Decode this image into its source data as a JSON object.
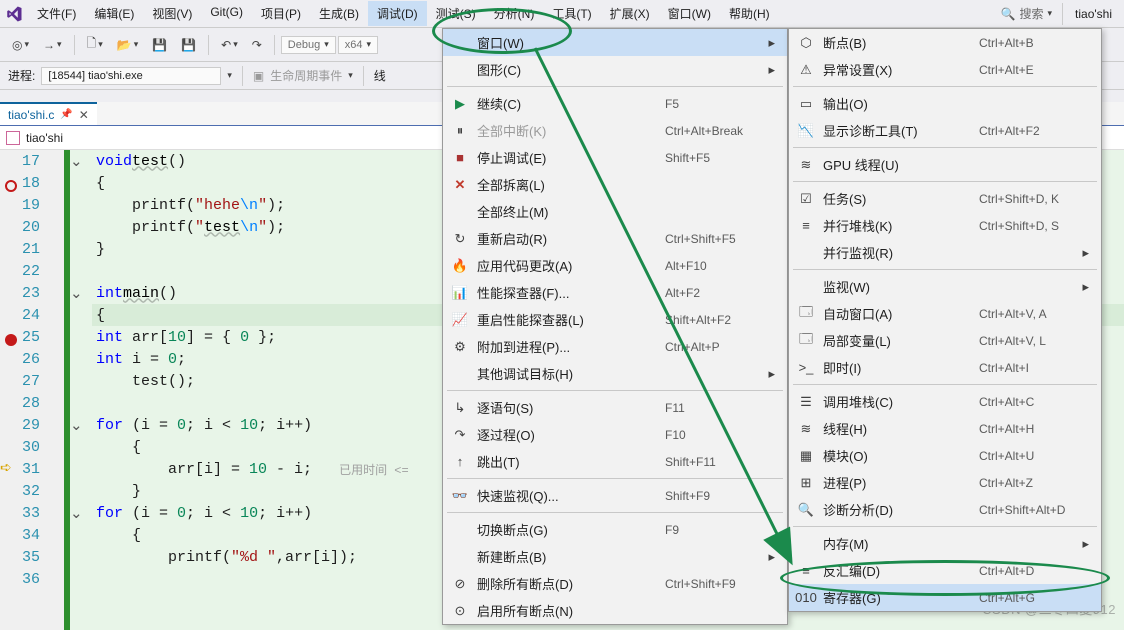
{
  "menubar": [
    "文件(F)",
    "编辑(E)",
    "视图(V)",
    "Git(G)",
    "项目(P)",
    "生成(B)",
    "调试(D)",
    "测试(S)",
    "分析(N)",
    "工具(T)",
    "扩展(X)",
    "窗口(W)",
    "帮助(H)"
  ],
  "search_placeholder": "搜索",
  "title_right": "tiao'shi",
  "toolbar": {
    "config": "Debug",
    "platform": "x64"
  },
  "toolbar2": {
    "process_label": "进程:",
    "process_value": "[18544] tiao'shi.exe",
    "lifecycle": "生命周期事件",
    "thread_prefix": "线"
  },
  "tab": {
    "name": "tiao'shi.c"
  },
  "nav_combo": "tiao'shi",
  "code": {
    "lines": [
      {
        "n": 17,
        "fold": "v",
        "html": "<span class='kw'>void</span> <span class='fn-u'>test</span>()"
      },
      {
        "n": 18,
        "bp_hollow": true,
        "html": "{"
      },
      {
        "n": 19,
        "html": "    printf(<span class='str'>\"hehe<span class='esc'>\\n</span>\"</span>);"
      },
      {
        "n": 20,
        "html": "    printf(<span class='str'>\"<span class='fn-u'>test</span><span class='esc'>\\n</span>\"</span>);"
      },
      {
        "n": 21,
        "html": "}"
      },
      {
        "n": 22,
        "html": ""
      },
      {
        "n": 23,
        "fold": "v",
        "html": "<span class='kw'>int</span> <span class='fn-u'>main</span>()"
      },
      {
        "n": 24,
        "hl": true,
        "html": "{"
      },
      {
        "n": 25,
        "bp": true,
        "html": "    <span class='kw'>int</span> arr[<span class='num'>10</span>] = { <span class='num'>0</span> };"
      },
      {
        "n": 26,
        "html": "    <span class='kw'>int</span> i = <span class='num'>0</span>;"
      },
      {
        "n": 27,
        "html": "    test();"
      },
      {
        "n": 28,
        "html": ""
      },
      {
        "n": 29,
        "fold": "v",
        "html": "    <span class='kw'>for</span> (i = <span class='num'>0</span>; i &lt; <span class='num'>10</span>; i++)"
      },
      {
        "n": 30,
        "html": "    {"
      },
      {
        "n": 31,
        "cur": true,
        "html": "        arr[i] = <span class='num'>10</span> - i;   <span class='inline-hint'>已用时间 &lt;=</span>"
      },
      {
        "n": 32,
        "html": "    }"
      },
      {
        "n": 33,
        "fold": "v",
        "html": "    <span class='kw'>for</span> (i = <span class='num'>0</span>; i &lt; <span class='num'>10</span>; i++)"
      },
      {
        "n": 34,
        "html": "    {"
      },
      {
        "n": 35,
        "html": "        printf(<span class='str'>\"%d \"</span>,arr[i]);"
      },
      {
        "n": 36,
        "html": "    "
      }
    ]
  },
  "menu1": [
    {
      "t": "hover",
      "label": "窗口(W)",
      "sub": true
    },
    {
      "t": "mi",
      "label": "图形(C)",
      "sub": true
    },
    {
      "t": "sep"
    },
    {
      "t": "mi",
      "icon": "green-tri",
      "label": "继续(C)",
      "sc": "F5"
    },
    {
      "t": "mi",
      "icon": "pause-icon",
      "label": "全部中断(K)",
      "sc": "Ctrl+Alt+Break",
      "disabled": true
    },
    {
      "t": "mi",
      "icon": "stop-icon",
      "label": "停止调试(E)",
      "sc": "Shift+F5"
    },
    {
      "t": "mi",
      "icon": "red-x",
      "label": "全部拆离(L)"
    },
    {
      "t": "mi",
      "label": "全部终止(M)"
    },
    {
      "t": "mi",
      "icon": "restart-icon",
      "label": "重新启动(R)",
      "sc": "Ctrl+Shift+F5"
    },
    {
      "t": "mi",
      "icon": "flame-icon",
      "label": "应用代码更改(A)",
      "sc": "Alt+F10"
    },
    {
      "t": "mi",
      "icon": "perf-icon",
      "label": "性能探查器(F)...",
      "sc": "Alt+F2"
    },
    {
      "t": "mi",
      "icon": "perf2-icon",
      "label": "重启性能探查器(L)",
      "sc": "Shift+Alt+F2"
    },
    {
      "t": "mi",
      "icon": "attach-icon",
      "label": "附加到进程(P)...",
      "sc": "Ctrl+Alt+P"
    },
    {
      "t": "mi",
      "label": "其他调试目标(H)",
      "sub": true
    },
    {
      "t": "sep"
    },
    {
      "t": "mi",
      "icon": "stepin-icon",
      "label": "逐语句(S)",
      "sc": "F11"
    },
    {
      "t": "mi",
      "icon": "stepover-icon",
      "label": "逐过程(O)",
      "sc": "F10"
    },
    {
      "t": "mi",
      "icon": "stepout-icon",
      "label": "跳出(T)",
      "sc": "Shift+F11"
    },
    {
      "t": "sep"
    },
    {
      "t": "mi",
      "icon": "watch-icon",
      "label": "快速监视(Q)...",
      "sc": "Shift+F9"
    },
    {
      "t": "sep"
    },
    {
      "t": "mi",
      "label": "切换断点(G)",
      "sc": "F9"
    },
    {
      "t": "mi",
      "label": "新建断点(B)",
      "sub": true
    },
    {
      "t": "mi",
      "icon": "delbp-icon",
      "label": "删除所有断点(D)",
      "sc": "Ctrl+Shift+F9"
    },
    {
      "t": "mi",
      "icon": "disbp-icon",
      "label": "启用所有断点(N)"
    }
  ],
  "menu2": [
    {
      "t": "mi",
      "icon": "bp-icon",
      "label": "断点(B)",
      "sc": "Ctrl+Alt+B"
    },
    {
      "t": "mi",
      "icon": "exc-icon",
      "label": "异常设置(X)",
      "sc": "Ctrl+Alt+E"
    },
    {
      "t": "sep"
    },
    {
      "t": "mi",
      "icon": "out-icon",
      "label": "输出(O)"
    },
    {
      "t": "mi",
      "icon": "diag-icon",
      "label": "显示诊断工具(T)",
      "sc": "Ctrl+Alt+F2"
    },
    {
      "t": "sep"
    },
    {
      "t": "mi",
      "icon": "gpu-icon",
      "label": "GPU 线程(U)"
    },
    {
      "t": "sep"
    },
    {
      "t": "mi",
      "icon": "task-icon",
      "label": "任务(S)",
      "sc": "Ctrl+Shift+D, K"
    },
    {
      "t": "mi",
      "icon": "pstk-icon",
      "label": "并行堆栈(K)",
      "sc": "Ctrl+Shift+D, S"
    },
    {
      "t": "mi",
      "label": "并行监视(R)",
      "sub": true
    },
    {
      "t": "sep"
    },
    {
      "t": "mi",
      "label": "监视(W)",
      "sub": true
    },
    {
      "t": "mi",
      "icon": "auto-icon",
      "label": "自动窗口(A)",
      "sc": "Ctrl+Alt+V, A"
    },
    {
      "t": "mi",
      "icon": "local-icon",
      "label": "局部变量(L)",
      "sc": "Ctrl+Alt+V, L"
    },
    {
      "t": "mi",
      "icon": "imm-icon",
      "label": "即时(I)",
      "sc": "Ctrl+Alt+I"
    },
    {
      "t": "sep"
    },
    {
      "t": "mi",
      "icon": "cstk-icon",
      "label": "调用堆栈(C)",
      "sc": "Ctrl+Alt+C"
    },
    {
      "t": "mi",
      "icon": "thr-icon",
      "label": "线程(H)",
      "sc": "Ctrl+Alt+H"
    },
    {
      "t": "mi",
      "icon": "mod-icon",
      "label": "模块(O)",
      "sc": "Ctrl+Alt+U"
    },
    {
      "t": "mi",
      "icon": "proc-icon",
      "label": "进程(P)",
      "sc": "Ctrl+Alt+Z"
    },
    {
      "t": "mi",
      "icon": "diag2-icon",
      "label": "诊断分析(D)",
      "sc": "Ctrl+Shift+Alt+D"
    },
    {
      "t": "sep"
    },
    {
      "t": "mi",
      "label": "内存(M)",
      "sub": true
    },
    {
      "t": "mi",
      "icon": "asm-icon",
      "label": "反汇编(D)",
      "sc": "Ctrl+Alt+D"
    },
    {
      "t": "hover",
      "icon": "reg-icon",
      "label": "寄存器(G)",
      "sc": "Ctrl+Alt+G"
    }
  ],
  "watermark": "CSDN @三冬四夏912"
}
